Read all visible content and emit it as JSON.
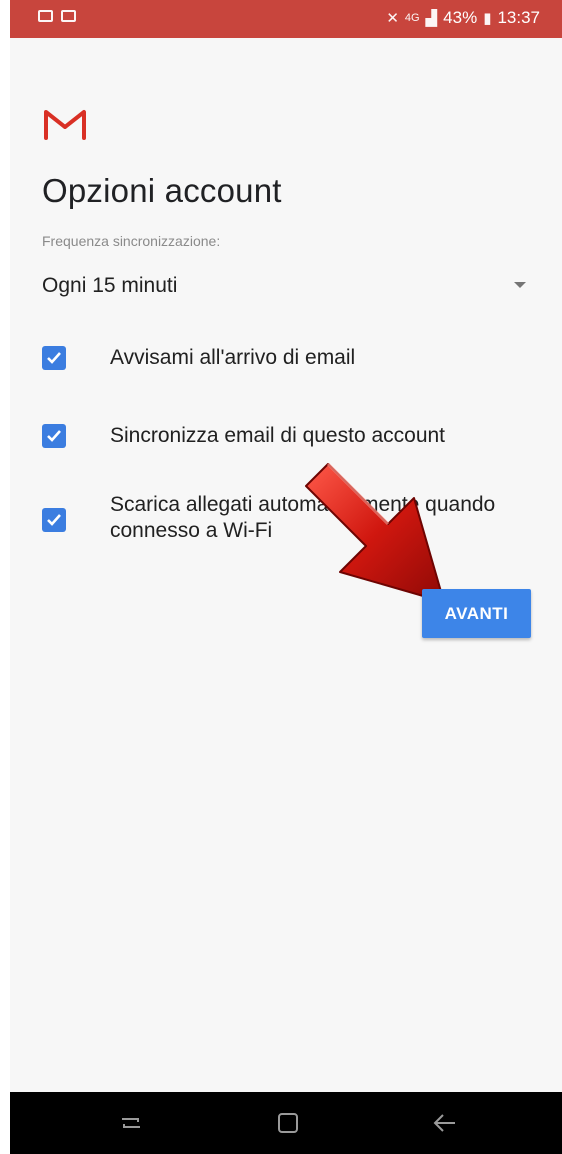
{
  "status_bar": {
    "battery": "43%",
    "time": "13:37",
    "signal_text": "4G",
    "icons": [
      "gallery-icon",
      "image-icon",
      "mute-icon",
      "signal-icon",
      "battery-icon"
    ]
  },
  "screen": {
    "title": "Opzioni account",
    "frequency_label": "Frequenza sincronizzazione:",
    "frequency_value": "Ogni 15 minuti"
  },
  "options": [
    {
      "label": "Avvisami all'arrivo di email",
      "checked": true
    },
    {
      "label": "Sincronizza email di questo account",
      "checked": true
    },
    {
      "label": "Scarica allegati automaticamente quando connesso a Wi-Fi",
      "checked": true
    }
  ],
  "next_button": {
    "label": "AVANTI"
  },
  "colors": {
    "status_bar": "#c8453d",
    "accent": "#3d85e8",
    "arrow": "#c0120e",
    "background": "#f7f7f7"
  }
}
